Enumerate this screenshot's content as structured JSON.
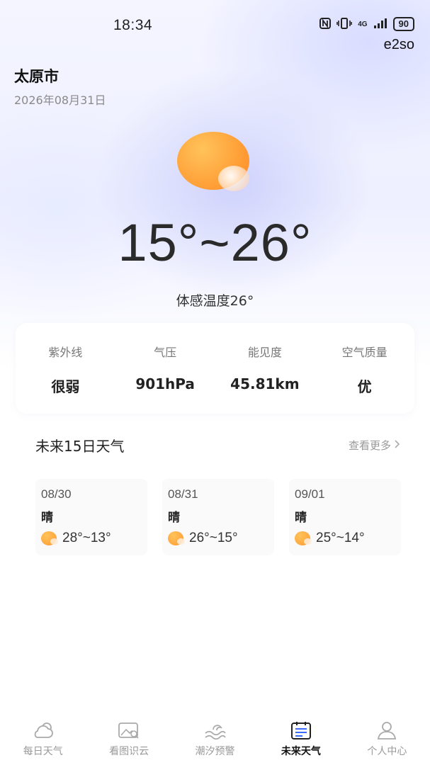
{
  "status_bar": {
    "time": "18:34",
    "network": "4G",
    "battery": "90"
  },
  "watermark": "e2so",
  "location": {
    "city": "太原市",
    "date": "2026年08月31日"
  },
  "today": {
    "icon": "sunny-cloud-icon",
    "temp_range": "15°~26°",
    "feels_like": "体感温度26°"
  },
  "stats": [
    {
      "label": "紫外线",
      "value": "很弱"
    },
    {
      "label": "气压",
      "value": "901hPa"
    },
    {
      "label": "能见度",
      "value": "45.81km"
    },
    {
      "label": "空气质量",
      "value": "优"
    }
  ],
  "forecast_section": {
    "title": "未来15日天气",
    "more_label": "查看更多"
  },
  "forecast": [
    {
      "date": "08/30",
      "condition": "晴",
      "temp": "28°~13°"
    },
    {
      "date": "08/31",
      "condition": "晴",
      "temp": "26°~15°"
    },
    {
      "date": "09/01",
      "condition": "晴",
      "temp": "25°~14°"
    }
  ],
  "tabs": [
    {
      "label": "每日天气",
      "icon": "cloud-sun-icon",
      "active": false
    },
    {
      "label": "看图识云",
      "icon": "image-search-icon",
      "active": false
    },
    {
      "label": "潮汐预警",
      "icon": "wave-icon",
      "active": false
    },
    {
      "label": "未来天气",
      "icon": "calendar-list-icon",
      "active": true
    },
    {
      "label": "个人中心",
      "icon": "person-icon",
      "active": false
    }
  ],
  "colors": {
    "accent_sun": "#ff9a32",
    "text_primary": "#222222",
    "text_secondary": "#8a8a8a"
  }
}
